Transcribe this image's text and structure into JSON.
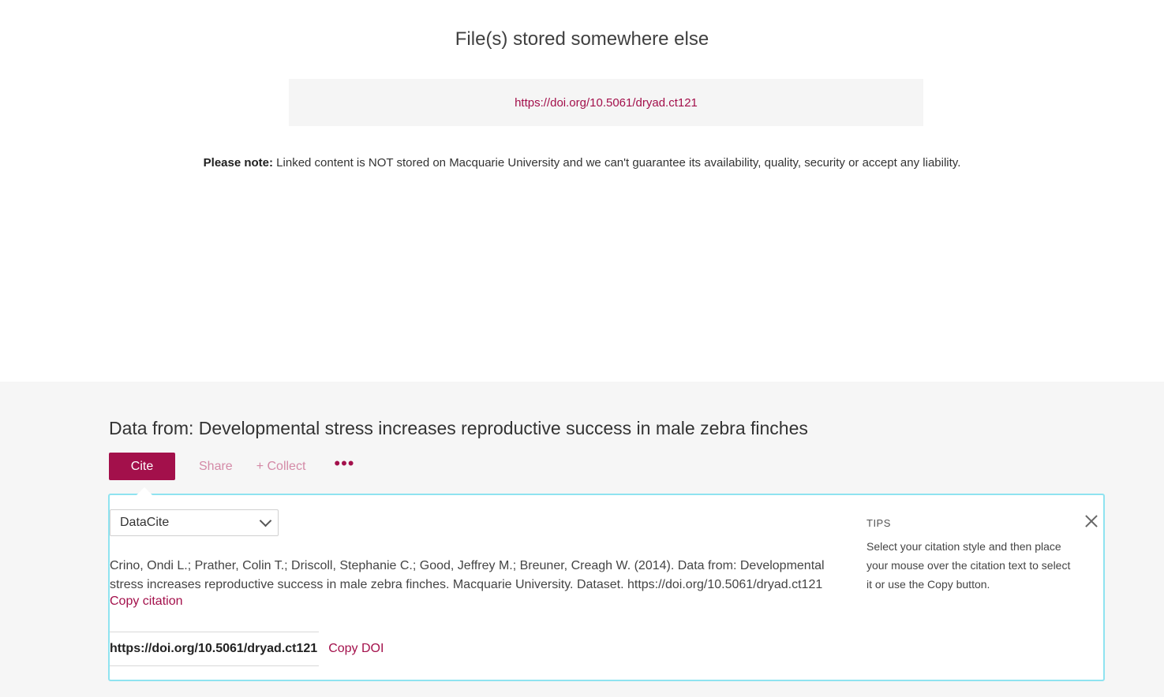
{
  "files": {
    "heading": "File(s) stored somewhere else",
    "link": "https://doi.org/10.5061/dryad.ct121",
    "note_label": "Please note:",
    "note_text": " Linked content is NOT stored on Macquarie University and we can't guarantee its availability, quality, security or accept any liability."
  },
  "dataset": {
    "title": "Data from: Developmental stress increases reproductive success in male zebra finches",
    "actions": {
      "cite": "Cite",
      "share": "Share",
      "collect": "+ Collect",
      "more": "•••"
    }
  },
  "cite_panel": {
    "style_selected": "DataCite",
    "citation": "Crino, Ondi L.; Prather, Colin T.; Driscoll, Stephanie C.; Good, Jeffrey M.; Breuner, Creagh W. (2014). Data from: Developmental stress increases reproductive success in male zebra finches. Macquarie University. Dataset. https://doi.org/10.5061/dryad.ct121",
    "copy_citation": "Copy citation",
    "doi": "https://doi.org/10.5061/dryad.ct121",
    "copy_doi": "Copy DOI",
    "tips_title": "TIPS",
    "tips_text": "Select your citation style and then place your mouse over the citation text to select it or use the Copy button."
  },
  "colors": {
    "accent": "#a3104b",
    "panel_border": "#8fe3f0",
    "footer_bg": "#f6f6f6"
  }
}
